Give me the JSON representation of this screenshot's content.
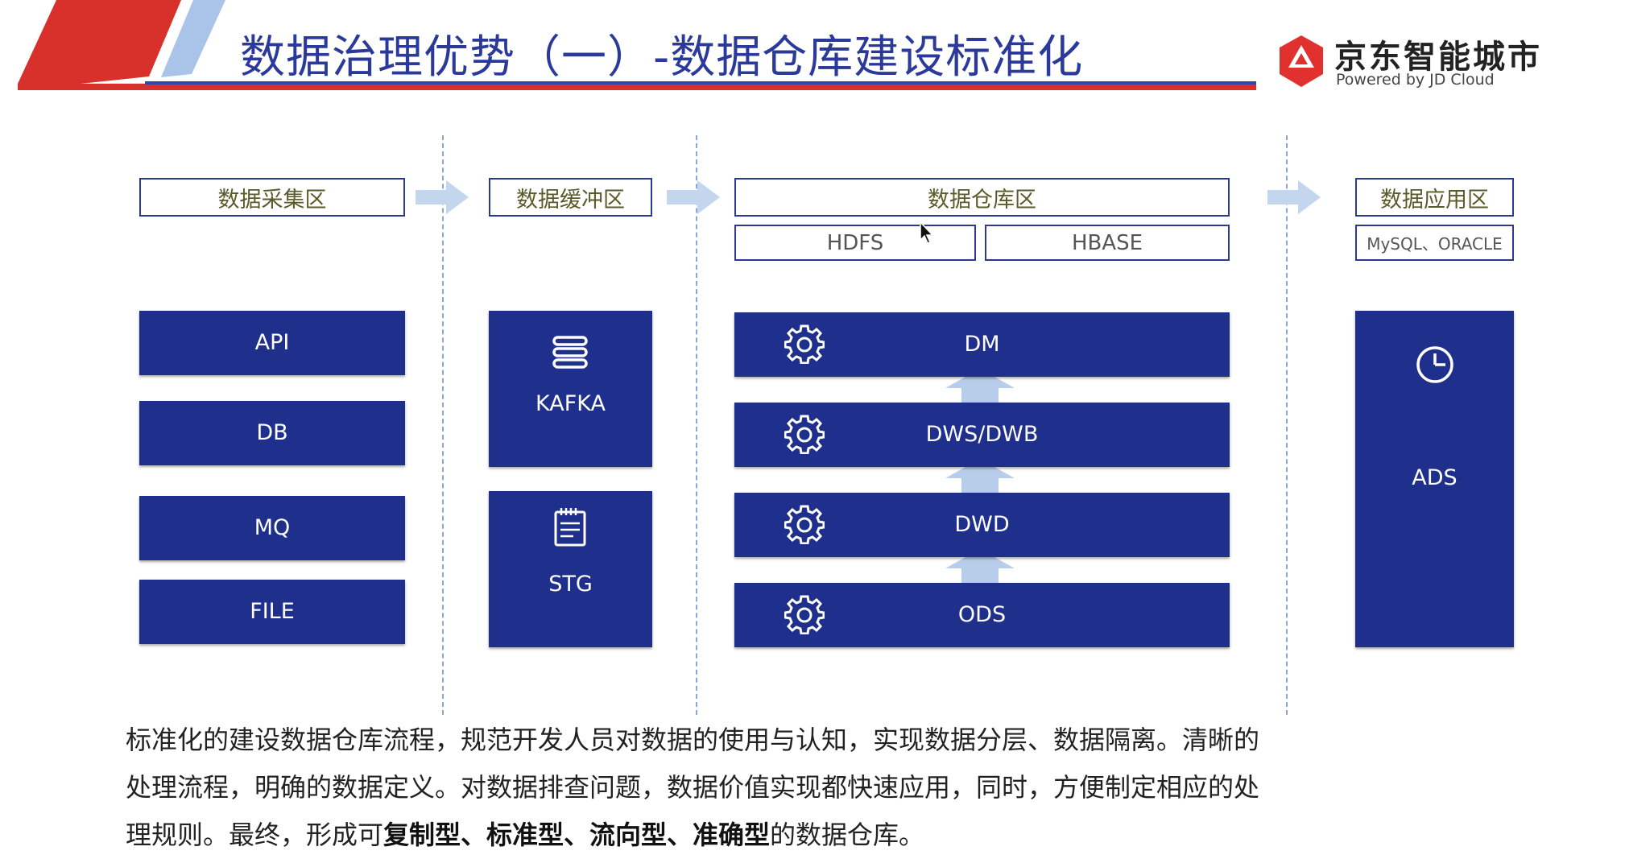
{
  "header": {
    "title": "数据治理优势（一）-数据仓库建设标准化",
    "brand_name": "京东智能城市",
    "brand_sub": "Powered by JD Cloud",
    "brand_color": "#e0312f",
    "accent_blue": "#2b3a9a"
  },
  "zones": {
    "collect": {
      "label": "数据采集区",
      "items": [
        "API",
        "DB",
        "MQ",
        "FILE"
      ]
    },
    "buffer": {
      "label": "数据缓冲区",
      "items": [
        "KAFKA",
        "STG"
      ]
    },
    "warehouse": {
      "label": "数据仓库区",
      "storage": [
        "HDFS",
        "HBASE"
      ],
      "layers": [
        "DM",
        "DWS/DWB",
        "DWD",
        "ODS"
      ]
    },
    "application": {
      "label": "数据应用区",
      "storage": "MySQL、ORACLE",
      "items": [
        "ADS"
      ]
    }
  },
  "icons": {
    "kafka": "stack-icon",
    "stg": "notepad-icon",
    "layer": "gear-icon",
    "ads": "pie-chart-icon",
    "flow": "arrow-right-icon",
    "up": "arrow-up-icon"
  },
  "colors": {
    "block": "#1f2f8c",
    "arrow": "#b8cdea",
    "zone_border": "#2b3990"
  },
  "description": {
    "part1": "标准化的建设数据仓库流程，规范开发人员对数据的使用与认知，实现数据分层、数据隔离。清晰的处理流程，明确的数据定义。对数据排查问题，数据价值实现都快速应用，同时，方便制定相应的处理规则。最终，形成可",
    "bold": "复制型、标准型、流向型、准确型",
    "part2": "的数据仓库。"
  }
}
